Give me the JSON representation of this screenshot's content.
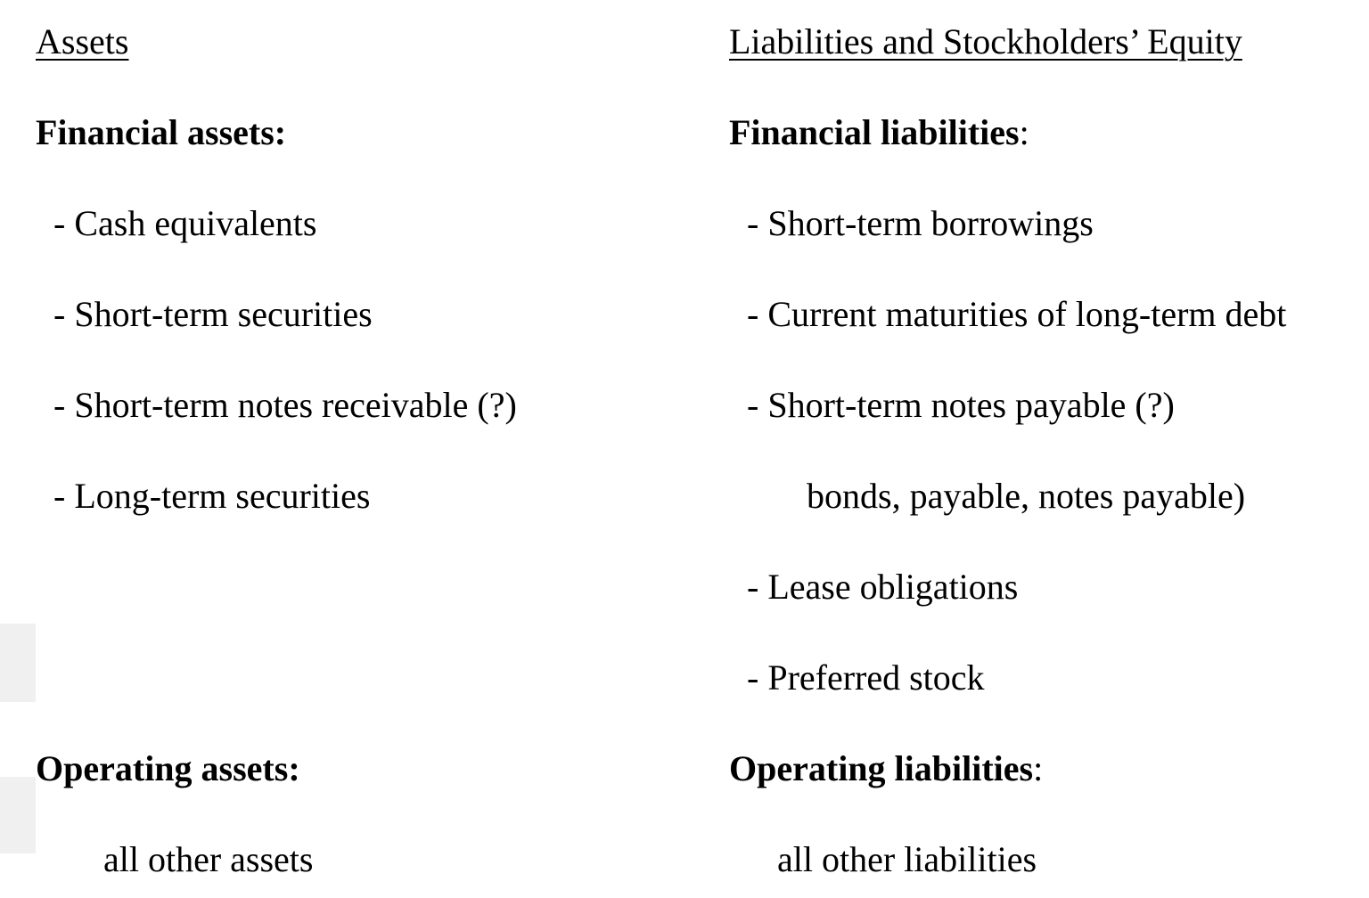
{
  "assets": {
    "heading": "Assets",
    "financial": {
      "title": "Financial assets:",
      "items": [
        "- Cash equivalents",
        "- Short-term securities",
        "- Short-term notes receivable (?)",
        "- Long-term securities"
      ]
    },
    "operating": {
      "title": "Operating assets:",
      "items": [
        "all other assets"
      ]
    }
  },
  "liabilities": {
    "heading": "Liabilities and Stockholders’ Equity",
    "financial": {
      "title": "Financial liabilities",
      "colon": ":",
      "items": [
        "- Short-term borrowings",
        "- Current maturities of long-term debt",
        "- Short-term notes payable (?)",
        "bonds, payable, notes payable)",
        "- Lease obligations",
        "- Preferred stock"
      ]
    },
    "operating": {
      "title": "Operating liabilities",
      "colon": ":",
      "items": [
        "all other liabilities"
      ]
    }
  }
}
